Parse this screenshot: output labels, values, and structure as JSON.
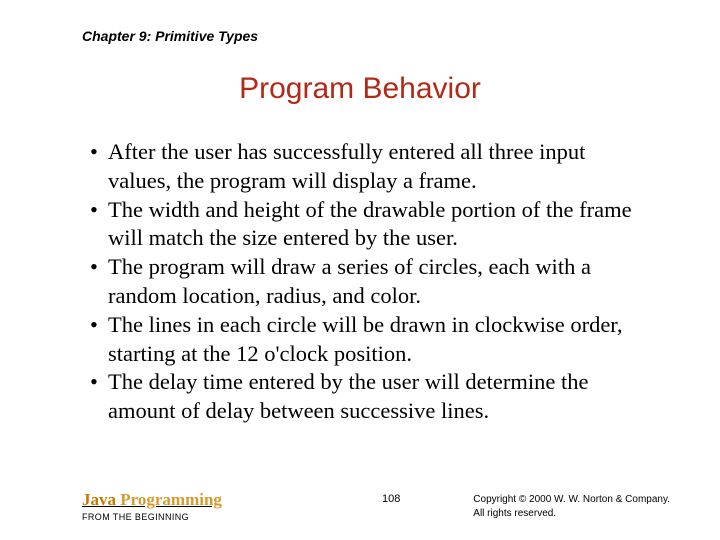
{
  "header": {
    "chapter": "Chapter 9: Primitive Types"
  },
  "title": "Program Behavior",
  "bullets": [
    "After the user has successfully entered all three input values, the program will display a frame.",
    "The width and height of the drawable portion of the frame will match the size entered by the user.",
    "The program will draw a series of circles, each with a random location, radius, and color.",
    "The lines in each circle will be drawn in clockwise order, starting at the 12 o'clock position.",
    "The delay time entered by the user will determine the amount of delay between successive lines."
  ],
  "footer": {
    "book_title_java": "Java ",
    "book_title_prog": "Programming",
    "subtitle": "FROM THE BEGINNING",
    "page_number": "108",
    "copyright_line1": "Copyright © 2000 W. W. Norton & Company.",
    "copyright_line2": "All rights reserved."
  }
}
